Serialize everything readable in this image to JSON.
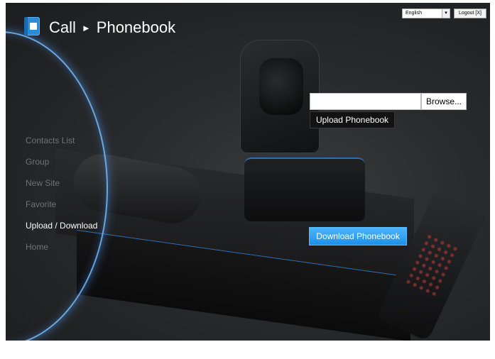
{
  "header": {
    "app_icon": "phonebook-icon",
    "breadcrumb": {
      "section": "Call",
      "separator": "►",
      "page": "Phonebook"
    },
    "language": {
      "selected": "English"
    },
    "logout_label": "Logout [X]"
  },
  "nav": {
    "items": [
      {
        "label": "Contacts List",
        "active": false
      },
      {
        "label": "Group",
        "active": false
      },
      {
        "label": "New Site",
        "active": false
      },
      {
        "label": "Favorite",
        "active": false
      },
      {
        "label": "Upload / Download",
        "active": true
      },
      {
        "label": "Home",
        "active": false
      }
    ]
  },
  "upload": {
    "file_value": "",
    "browse_label": "Browse...",
    "upload_label": "Upload Phonebook"
  },
  "download": {
    "label": "Download Phonebook"
  },
  "colors": {
    "accent": "#2c8bd6",
    "download_button": "#2a9af0",
    "nav_inactive": "#6f7173",
    "nav_active": "#ffffff"
  }
}
